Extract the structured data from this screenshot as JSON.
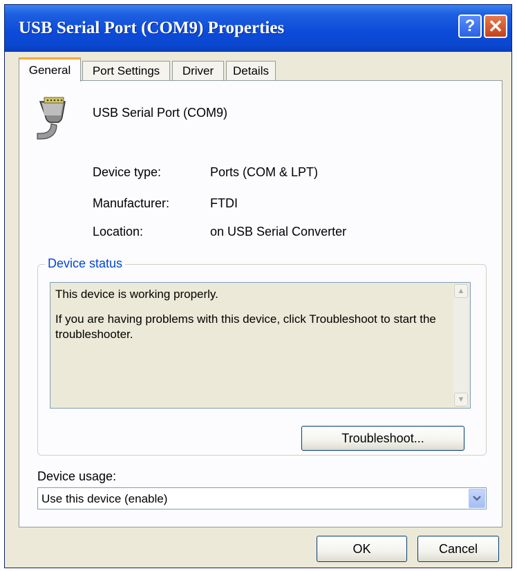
{
  "window": {
    "title": "USB Serial Port (COM9) Properties",
    "help_symbol": "?",
    "close_symbol": "✕"
  },
  "tabs": [
    {
      "label": "General",
      "active": true
    },
    {
      "label": "Port Settings",
      "active": false
    },
    {
      "label": "Driver",
      "active": false
    },
    {
      "label": "Details",
      "active": false
    }
  ],
  "device": {
    "icon": "serial-port-plug-icon",
    "name": "USB Serial Port (COM9)"
  },
  "properties": [
    {
      "label": "Device type:",
      "value": "Ports (COM & LPT)"
    },
    {
      "label": "Manufacturer:",
      "value": "FTDI"
    },
    {
      "label": "Location:",
      "value": "on USB Serial Converter"
    }
  ],
  "status": {
    "group_title": "Device status",
    "line1": "This device is working properly.",
    "line2": "If you are having problems with this device, click Troubleshoot to start the troubleshooter.",
    "troubleshoot_label": "Troubleshoot..."
  },
  "usage": {
    "label": "Device usage:",
    "selected": "Use this device (enable)"
  },
  "footer": {
    "ok_label": "OK",
    "cancel_label": "Cancel"
  },
  "colors": {
    "titlebar": "#0b48d0",
    "dialog_bg": "#ece9d8",
    "group_title": "#0046d5",
    "active_tab_accent": "#f4a73c"
  }
}
